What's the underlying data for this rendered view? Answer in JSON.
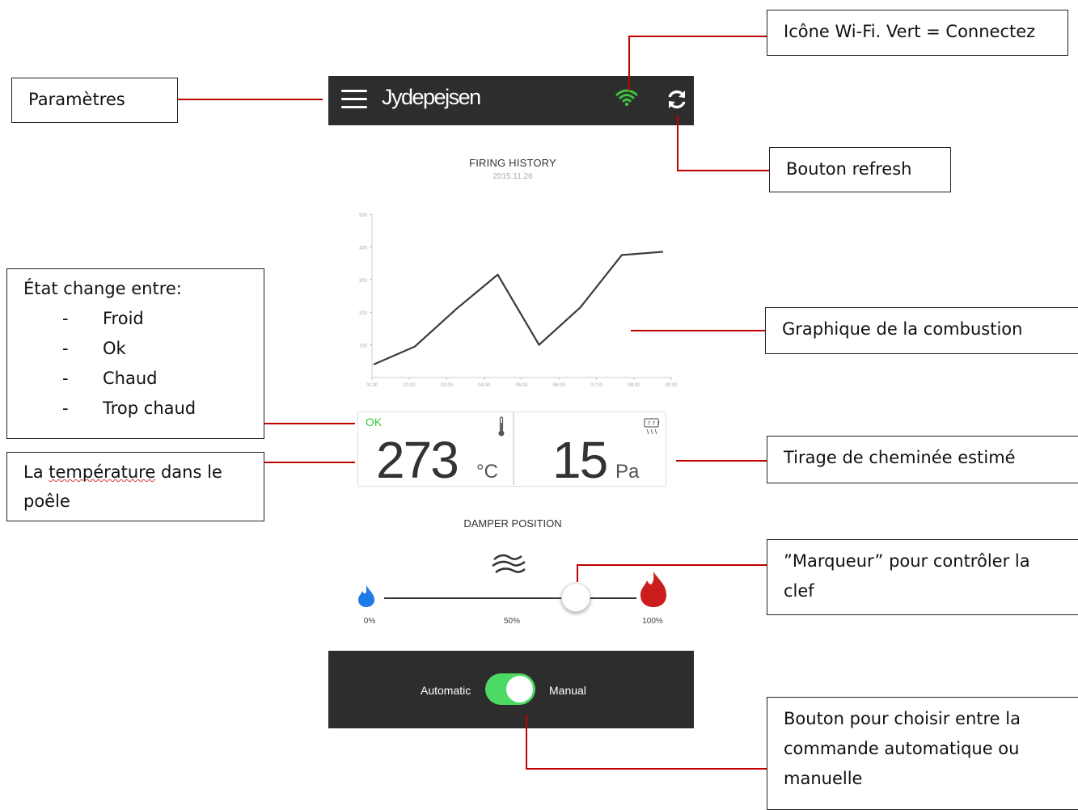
{
  "app": {
    "brand": "Jydepejsen",
    "menu_icon": "hamburger-icon",
    "wifi_icon": "wifi-icon",
    "refresh_icon": "refresh-icon",
    "wifi_color": "#3cc43c",
    "bar_color": "#2d2d2d"
  },
  "chart_data": {
    "type": "line",
    "title": "FIRING HISTORY",
    "subtitle": "2015.11.26",
    "x": [
      "01:00",
      "02:00",
      "03:00",
      "04:00",
      "05:00",
      "06:00",
      "07:00",
      "08:00",
      "09:00"
    ],
    "y_ticks": [
      "100",
      "200",
      "300",
      "400",
      "500"
    ],
    "ylim": [
      0,
      500
    ],
    "series": [
      {
        "values": [
          40,
          95,
          210,
          315,
          100,
          215,
          375,
          385
        ]
      }
    ],
    "grid": false
  },
  "readings": {
    "status": "OK",
    "temperature_value": "273",
    "temperature_unit": "°C",
    "draft_value": "15",
    "draft_unit": "Pa",
    "thermometer_icon": "thermometer-icon",
    "chimney_icon": "chimney-icon"
  },
  "damper": {
    "title": "DAMPER POSITION",
    "airflow_icon": "airflow-icon",
    "low_icon": "blue-flame-icon",
    "high_icon": "red-flame-icon",
    "labels": [
      "0%",
      "50%",
      "100%"
    ],
    "position_fraction": 0.76
  },
  "mode": {
    "automatic_label": "Automatic",
    "manual_label": "Manual",
    "toggle_on": true,
    "toggle_color": "#4cd964"
  },
  "callouts": {
    "wifi": "Icône Wi-Fi. Vert = Connectez",
    "settings": "Paramètres",
    "refresh": "Bouton refresh",
    "state_heading": "État change entre:",
    "state_items": [
      "Froid",
      "Ok",
      "Chaud",
      "Trop chaud"
    ],
    "chart": "Graphique de la combustion",
    "temperature_line1": "La",
    "temperature_word": "température",
    "temperature_rest": "dans le",
    "temperature_line2": "poêle",
    "draft": "Tirage de cheminée estimé",
    "marker_line1": "”Marqueur” pour contrôler la",
    "marker_line2": "clef",
    "toggle_line1": "Bouton pour choisir entre la",
    "toggle_line2": "commande automatique ou",
    "toggle_line3": "manuelle"
  }
}
